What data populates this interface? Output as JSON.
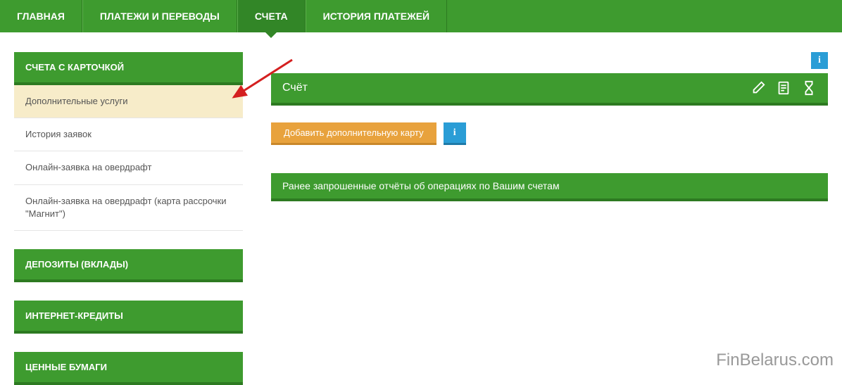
{
  "nav": {
    "items": [
      {
        "label": "ГЛАВНАЯ",
        "active": false
      },
      {
        "label": "ПЛАТЕЖИ И ПЕРЕВОДЫ",
        "active": false
      },
      {
        "label": "СЧЕТА",
        "active": true
      },
      {
        "label": "ИСТОРИЯ ПЛАТЕЖЕЙ",
        "active": false
      }
    ]
  },
  "sidebar": {
    "header": "СЧЕТА С КАРТОЧКОЙ",
    "items": [
      {
        "label": "Дополнительные услуги",
        "selected": true
      },
      {
        "label": "История заявок",
        "selected": false
      },
      {
        "label": "Онлайн-заявка на овердрафт",
        "selected": false
      },
      {
        "label": "Онлайн-заявка на овердрафт (карта рассрочки \"Магнит\")",
        "selected": false
      }
    ],
    "blocks": [
      "ДЕПОЗИТЫ (ВКЛАДЫ)",
      "ИНТЕРНЕТ-КРЕДИТЫ",
      "ЦЕННЫЕ БУМАГИ"
    ]
  },
  "main": {
    "info_badge": "i",
    "account_label": "Счёт",
    "add_card_btn": "Добавить дополнительную карту",
    "add_card_info": "i",
    "reports_label": "Ранее запрошенные отчёты об операциях по Вашим счетам"
  },
  "watermark": "FinBelarus.com"
}
